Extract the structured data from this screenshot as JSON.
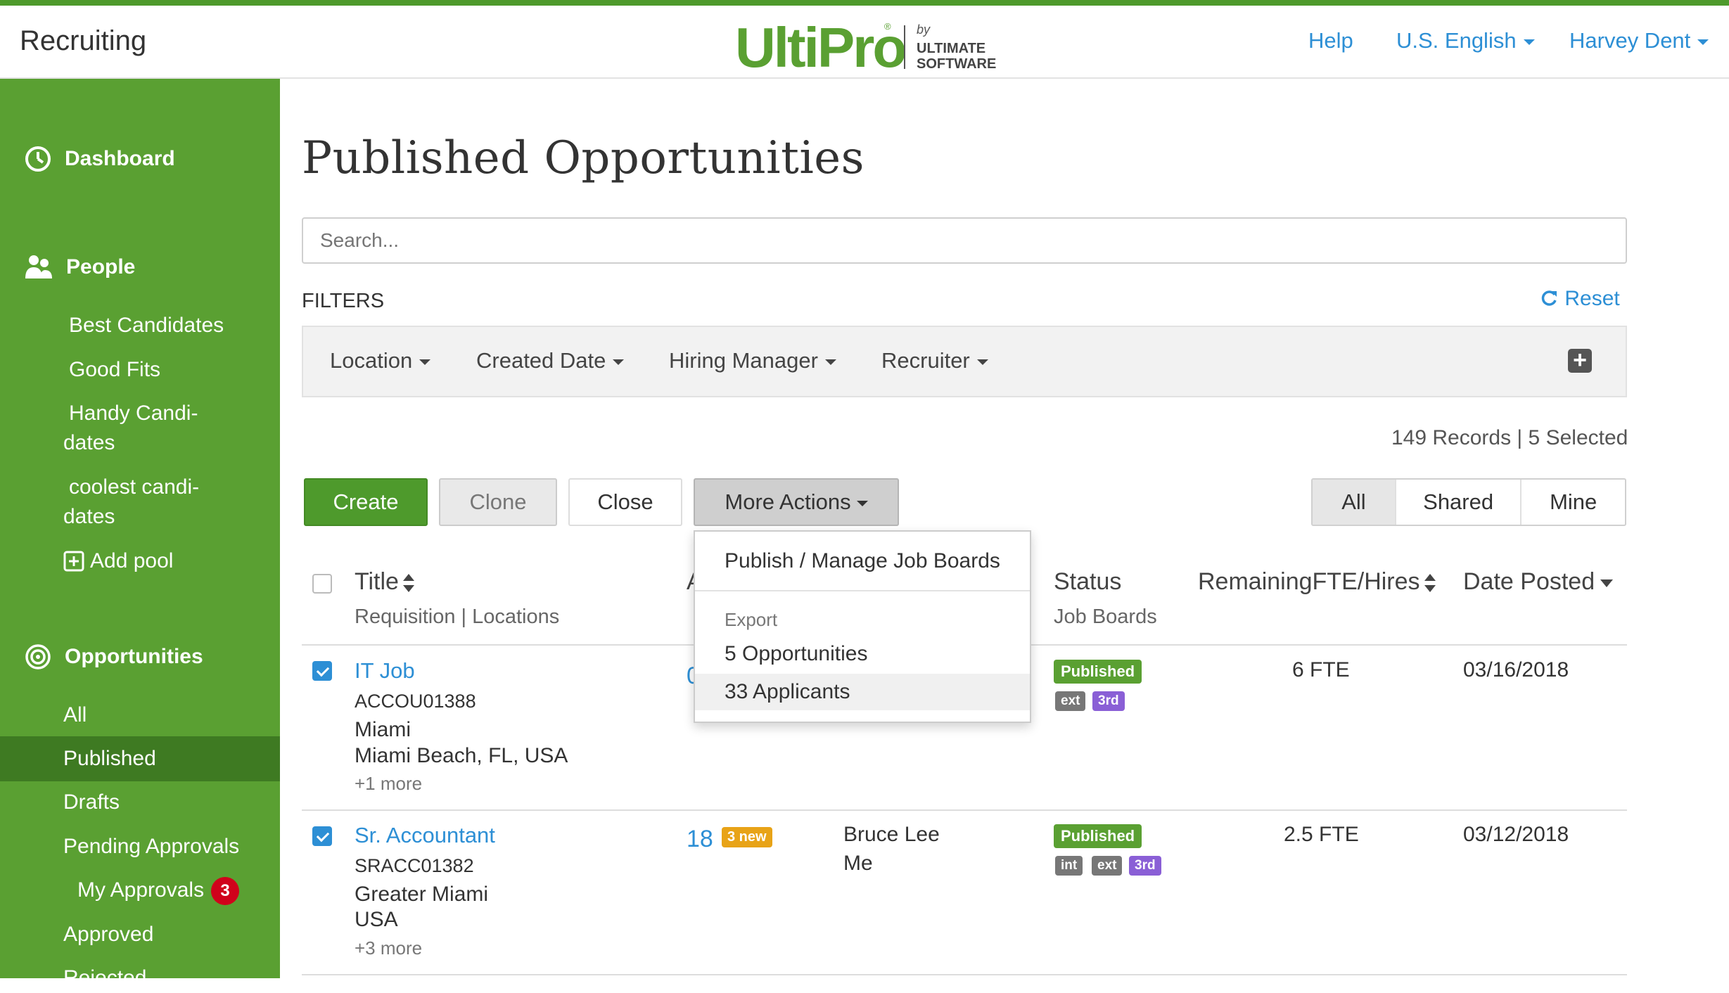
{
  "app": {
    "title": "Recruiting"
  },
  "logo": {
    "word": "UltiPro",
    "reg": "®",
    "by": "by",
    "company": "ULTIMATE\nSOFTWARE"
  },
  "header_nav": {
    "help": "Help",
    "language": "U.S. English",
    "user": "Harvey Dent"
  },
  "sidebar": {
    "dashboard": "Dashboard",
    "people": "People",
    "people_items": [
      "Best Candidates",
      "Good Fits",
      "Handy Candi-",
      "dates",
      "coolest candi-",
      "dates"
    ],
    "add_pool": "Add pool",
    "opportunities": "Opportunities",
    "opp_items": {
      "all": "All",
      "published": "Published",
      "drafts": "Drafts",
      "pending": "Pending Approvals",
      "my_approvals": "My Approvals",
      "my_approvals_count": "3",
      "approved": "Approved",
      "rejected": "Rejected"
    }
  },
  "page": {
    "title": "Published Opportunities",
    "search_placeholder": "Search..."
  },
  "filters": {
    "label": "FILTERS",
    "reset": "Reset",
    "items": [
      "Location",
      "Created Date",
      "Hiring Manager",
      "Recruiter"
    ]
  },
  "records": {
    "text": "149 Records | 5 Selected"
  },
  "actions": {
    "create": "Create",
    "clone": "Clone",
    "close": "Close",
    "more": "More Actions"
  },
  "view_toggle": {
    "all": "All",
    "shared": "Shared",
    "mine": "Mine",
    "selected": "All"
  },
  "dropdown": {
    "publish": "Publish / Manage Job Boards",
    "export_header": "Export",
    "opportunities": "5 Opportunities",
    "applicants": "33 Applicants"
  },
  "table": {
    "headers": {
      "title": "Title",
      "title_sub": "Requisition | Locations",
      "applicants_initial": "A",
      "status": "Status",
      "status_sub": "Job Boards",
      "remaining": "RemainingFTE/Hires",
      "date": "Date Posted"
    },
    "rows": [
      {
        "title": "IT Job",
        "req": "ACCOU01388",
        "loc1": "Miami",
        "loc2": "Miami Beach, FL, USA",
        "more": "+1 more",
        "applicants": "0",
        "status": "Published",
        "boards": [
          "ext",
          "3rd"
        ],
        "fte": "6 FTE",
        "date": "03/16/2018"
      },
      {
        "title": "Sr. Accountant",
        "req": "SRACC01382",
        "loc1": "Greater Miami",
        "loc2": "USA",
        "more": "+3 more",
        "applicants": "18",
        "new": "3 new",
        "manager": "Bruce Lee",
        "recruiter": "Me",
        "status": "Published",
        "boards": [
          "int",
          "ext",
          "3rd"
        ],
        "fte": "2.5 FTE",
        "date": "03/12/2018"
      }
    ]
  },
  "colors": {
    "brand_green": "#5aa032",
    "active_green": "#3e7a22",
    "link_blue": "#2d8fd5",
    "badge_red": "#d0021b",
    "tag_purple": "#8a5fd6",
    "new_orange": "#e8a317"
  }
}
